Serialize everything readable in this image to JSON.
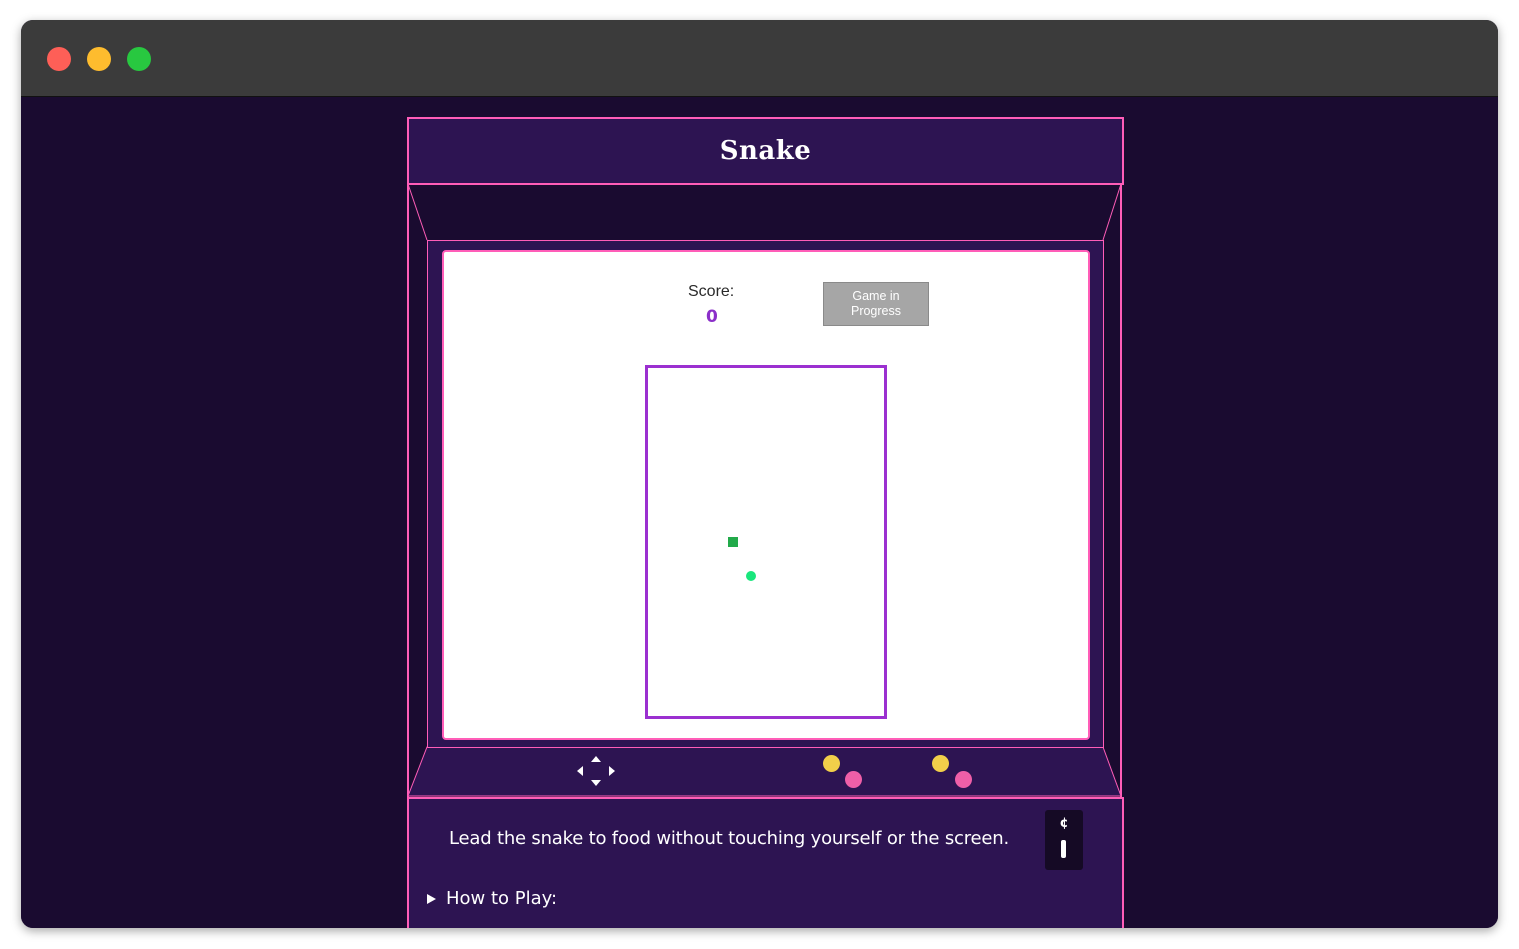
{
  "window": {
    "controls": [
      "close",
      "minimize",
      "maximize"
    ]
  },
  "game": {
    "title": "Snake",
    "score_label": "Score:",
    "score_value": "0",
    "status_button": "Game in Progress",
    "description": "Lead the snake to food without touching yourself or the screen.",
    "how_to_play": "How to Play:",
    "coin_symbol": "¢"
  },
  "colors": {
    "background": "#1a0b30",
    "cabinet": "#2d1452",
    "neon_border": "#ff5db8",
    "board_border": "#9b30d0",
    "score": "#8b2fc9",
    "snake": "#22aa4a",
    "food": "#19e67c",
    "button_yellow": "#f2cf4a",
    "button_pink": "#ef5fa8"
  },
  "icons": [
    "dpad-icon",
    "coin-slot-icon",
    "disclosure-triangle-icon"
  ]
}
